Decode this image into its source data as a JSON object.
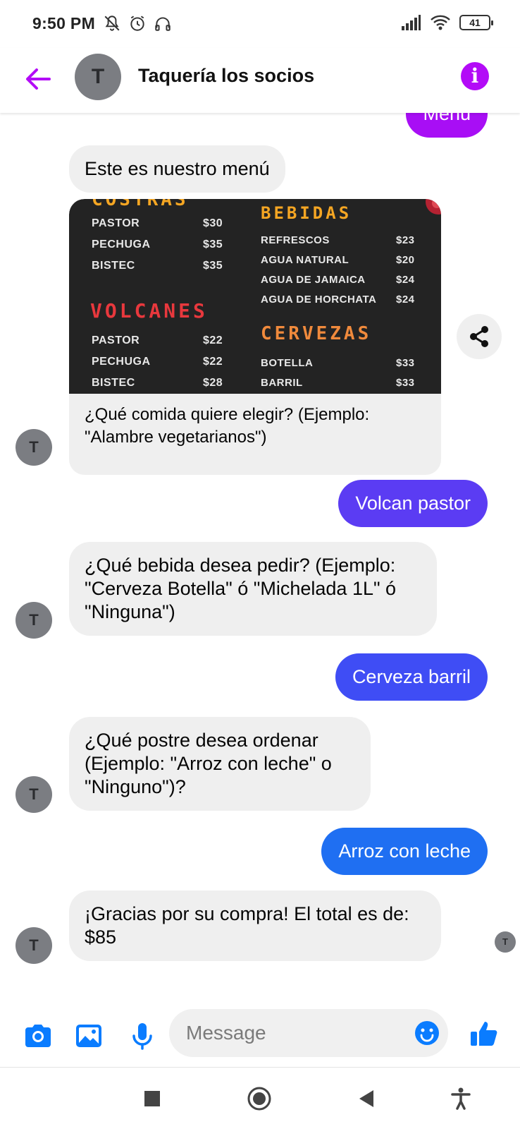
{
  "status_bar": {
    "time": "9:50 PM",
    "battery": "41",
    "icons_left": [
      "mute-icon",
      "alarm-icon",
      "headphones-icon"
    ],
    "icons_right": [
      "signal-icon",
      "wifi-icon",
      "battery-icon"
    ]
  },
  "header": {
    "title": "Taquería los socios",
    "avatar_initial": "T",
    "back_icon": "arrow-left-icon",
    "info_icon": "info-icon",
    "accent": "#b30bf7"
  },
  "messages": {
    "partial_top": "Menú",
    "bot_menu_intro": "Este es nuestro menú",
    "menu_image": {
      "columns": [
        {
          "partial_heading": "COSTRAS",
          "items": [
            {
              "name": "PASTOR",
              "price": "$30"
            },
            {
              "name": "PECHUGA",
              "price": "$35"
            },
            {
              "name": "BISTEC",
              "price": "$35"
            }
          ],
          "heading2": "VOLCANES",
          "items2": [
            {
              "name": "PASTOR",
              "price": "$22"
            },
            {
              "name": "PECHUGA",
              "price": "$22"
            },
            {
              "name": "BISTEC",
              "price": "$28"
            }
          ]
        },
        {
          "heading": "BEBIDAS",
          "items": [
            {
              "name": "REFRESCOS",
              "price": "$23"
            },
            {
              "name": "AGUA NATURAL",
              "price": "$20"
            },
            {
              "name": "AGUA DE JAMAICA",
              "price": "$24"
            },
            {
              "name": "AGUA DE HORCHATA",
              "price": "$24"
            }
          ],
          "heading2": "CERVEZAS",
          "items2": [
            {
              "name": "BOTELLA",
              "price": "$33"
            },
            {
              "name": "BARRIL",
              "price": "$33"
            }
          ]
        }
      ],
      "heading_colors": {
        "orange": "#f5a623",
        "red": "#e8383d",
        "cervezas": "#f08a3c"
      }
    },
    "bot_menu_caption": "¿Qué comida quiere elegir? (Ejemplo: \"Alambre vegetarianos\")",
    "user_1": "Volcan pastor",
    "bot_2": "¿Qué bebida desea pedir? (Ejemplo: \"Cerveza Botella\" ó \"Michelada 1L\" ó \"Ninguna\")",
    "user_2": "Cerveza barril",
    "bot_3": "¿Qué postre desea ordenar (Ejemplo: \"Arroz con leche\" o \"Ninguno\")?",
    "user_3": "Arroz con leche",
    "bot_4": "¡Gracias por su compra! El total es de: $85",
    "avatar_initial": "T",
    "user_colors": [
      "#a80ef5",
      "#5b3cf3",
      "#3f4df5",
      "#1f6ff2"
    ]
  },
  "composer": {
    "placeholder": "Message",
    "icons": [
      "camera-icon",
      "gallery-icon",
      "microphone-icon",
      "emoji-icon",
      "thumbs-up-icon"
    ],
    "accent": "#0a7cff"
  },
  "nav_bar": {
    "icons": [
      "recents-icon",
      "home-icon",
      "back-icon",
      "accessibility-icon"
    ]
  }
}
